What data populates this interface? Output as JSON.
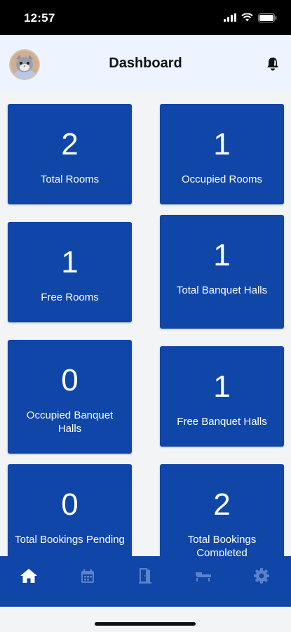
{
  "status_bar": {
    "time": "12:57",
    "icons": [
      "signal-icon",
      "wifi-icon",
      "battery-icon"
    ]
  },
  "header": {
    "title": "Dashboard",
    "avatar_icon": "cat-avatar-icon",
    "action_icon": "bell-icon"
  },
  "cards": [
    {
      "value": "2",
      "label": "Total Rooms"
    },
    {
      "value": "1",
      "label": "Occupied Rooms"
    },
    {
      "value": "1",
      "label": "Free Rooms"
    },
    {
      "value": "1",
      "label": "Total Banquet Halls"
    },
    {
      "value": "0",
      "label": "Occupied Banquet Halls"
    },
    {
      "value": "1",
      "label": "Free Banquet Halls"
    },
    {
      "value": "0",
      "label": "Total Bookings Pending"
    },
    {
      "value": "2",
      "label": "Total Bookings Completed"
    }
  ],
  "nav": {
    "items": [
      {
        "icon": "home-icon",
        "active": true
      },
      {
        "icon": "calendar-icon",
        "active": false
      },
      {
        "icon": "door-icon",
        "active": false
      },
      {
        "icon": "banquet-icon",
        "active": false
      },
      {
        "icon": "gear-icon",
        "active": false
      }
    ]
  },
  "colors": {
    "primary": "#0f46a8",
    "header_bg": "#eef4ff",
    "page_bg": "#f3f4f6",
    "inactive_icon": "#5d82c8",
    "active_icon": "#ffffff"
  }
}
